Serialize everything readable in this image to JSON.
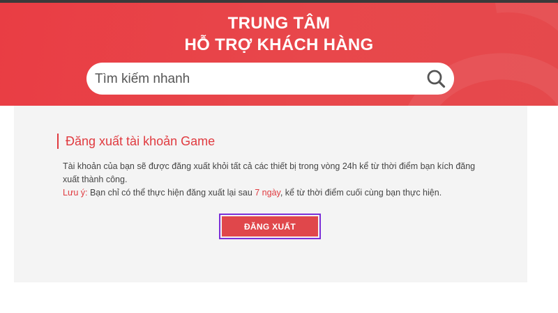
{
  "header": {
    "title_line1": "TRUNG TÂM",
    "title_line2": "HỖ TRỢ KHÁCH HÀNG"
  },
  "search": {
    "placeholder": "Tìm kiếm nhanh",
    "icon": "search-icon"
  },
  "section": {
    "title": "Đăng xuất tài khoản Game",
    "description": "Tài khoản của bạn sẽ được đăng xuất khỏi tất cả các thiết bị trong vòng 24h kể từ thời điểm bạn kích đăng xuất thành công.",
    "note_label": "Lưu ý:",
    "note_before": " Bạn chỉ có thể thực hiện đăng xuất lại sau ",
    "note_highlight": "7 ngày",
    "note_after": ", kể từ thời điểm cuối cùng bạn thực hiện.",
    "button_label": "ĐĂNG XUẤT"
  },
  "colors": {
    "brand_red": "#e93d44",
    "accent_text_red": "#e03a3f",
    "button_red": "#e0474b",
    "highlight_outline": "#7b2fd8",
    "content_bg": "#f4f4f4"
  }
}
